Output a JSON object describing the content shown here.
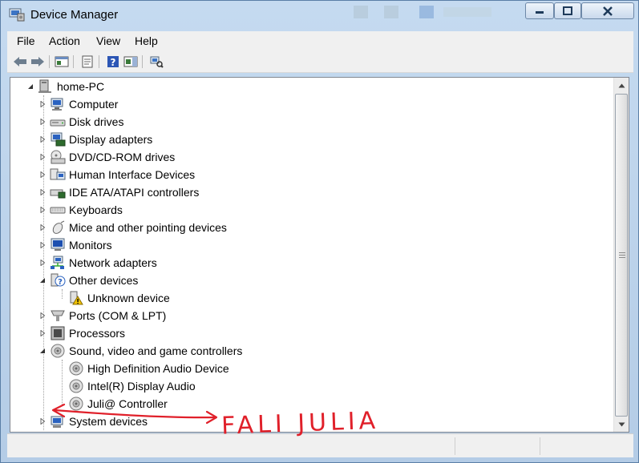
{
  "window": {
    "title": "Device Manager",
    "controls": {
      "minimize": "minimize-icon",
      "maximize": "maximize-icon",
      "close": "close-icon"
    }
  },
  "menu": {
    "items": [
      {
        "label": "File"
      },
      {
        "label": "Action"
      },
      {
        "label": "View"
      },
      {
        "label": "Help"
      }
    ]
  },
  "toolbar": {
    "buttons": [
      "back-icon",
      "forward-icon",
      "show-hide-console-tree-icon",
      "properties-icon",
      "help-icon",
      "action-pane-icon",
      "scan-hardware-icon"
    ]
  },
  "tree": {
    "root": {
      "label": "home-PC",
      "expanded": true
    },
    "categories": [
      {
        "label": "Computer",
        "icon": "computer-icon",
        "expanded": false
      },
      {
        "label": "Disk drives",
        "icon": "disk-drive-icon",
        "expanded": false
      },
      {
        "label": "Display adapters",
        "icon": "display-adapter-icon",
        "expanded": false
      },
      {
        "label": "DVD/CD-ROM drives",
        "icon": "dvd-drive-icon",
        "expanded": false
      },
      {
        "label": "Human Interface Devices",
        "icon": "hid-icon",
        "expanded": false
      },
      {
        "label": "IDE ATA/ATAPI controllers",
        "icon": "ide-controller-icon",
        "expanded": false
      },
      {
        "label": "Keyboards",
        "icon": "keyboard-icon",
        "expanded": false
      },
      {
        "label": "Mice and other pointing devices",
        "icon": "mouse-icon",
        "expanded": false
      },
      {
        "label": "Monitors",
        "icon": "monitor-icon",
        "expanded": false
      },
      {
        "label": "Network adapters",
        "icon": "network-adapter-icon",
        "expanded": false
      },
      {
        "label": "Other devices",
        "icon": "other-devices-icon",
        "expanded": true,
        "children": [
          {
            "label": "Unknown device",
            "icon": "unknown-device-warning-icon"
          }
        ]
      },
      {
        "label": "Ports (COM & LPT)",
        "icon": "port-icon",
        "expanded": false
      },
      {
        "label": "Processors",
        "icon": "processor-icon",
        "expanded": false
      },
      {
        "label": "Sound, video and game controllers",
        "icon": "sound-icon",
        "expanded": true,
        "children": [
          {
            "label": "High Definition Audio Device",
            "icon": "audio-device-icon"
          },
          {
            "label": "Intel(R) Display Audio",
            "icon": "audio-device-icon"
          },
          {
            "label": "Juli@ Controller",
            "icon": "audio-device-icon"
          }
        ]
      },
      {
        "label": "System devices",
        "icon": "system-devices-icon",
        "expanded": false
      }
    ]
  },
  "annotation": {
    "text": "FALI JULIA",
    "color": "#e0202a"
  },
  "colors": {
    "accent": "#1c5fb4",
    "warning": "#e8b800",
    "annotation": "#e0202a"
  }
}
